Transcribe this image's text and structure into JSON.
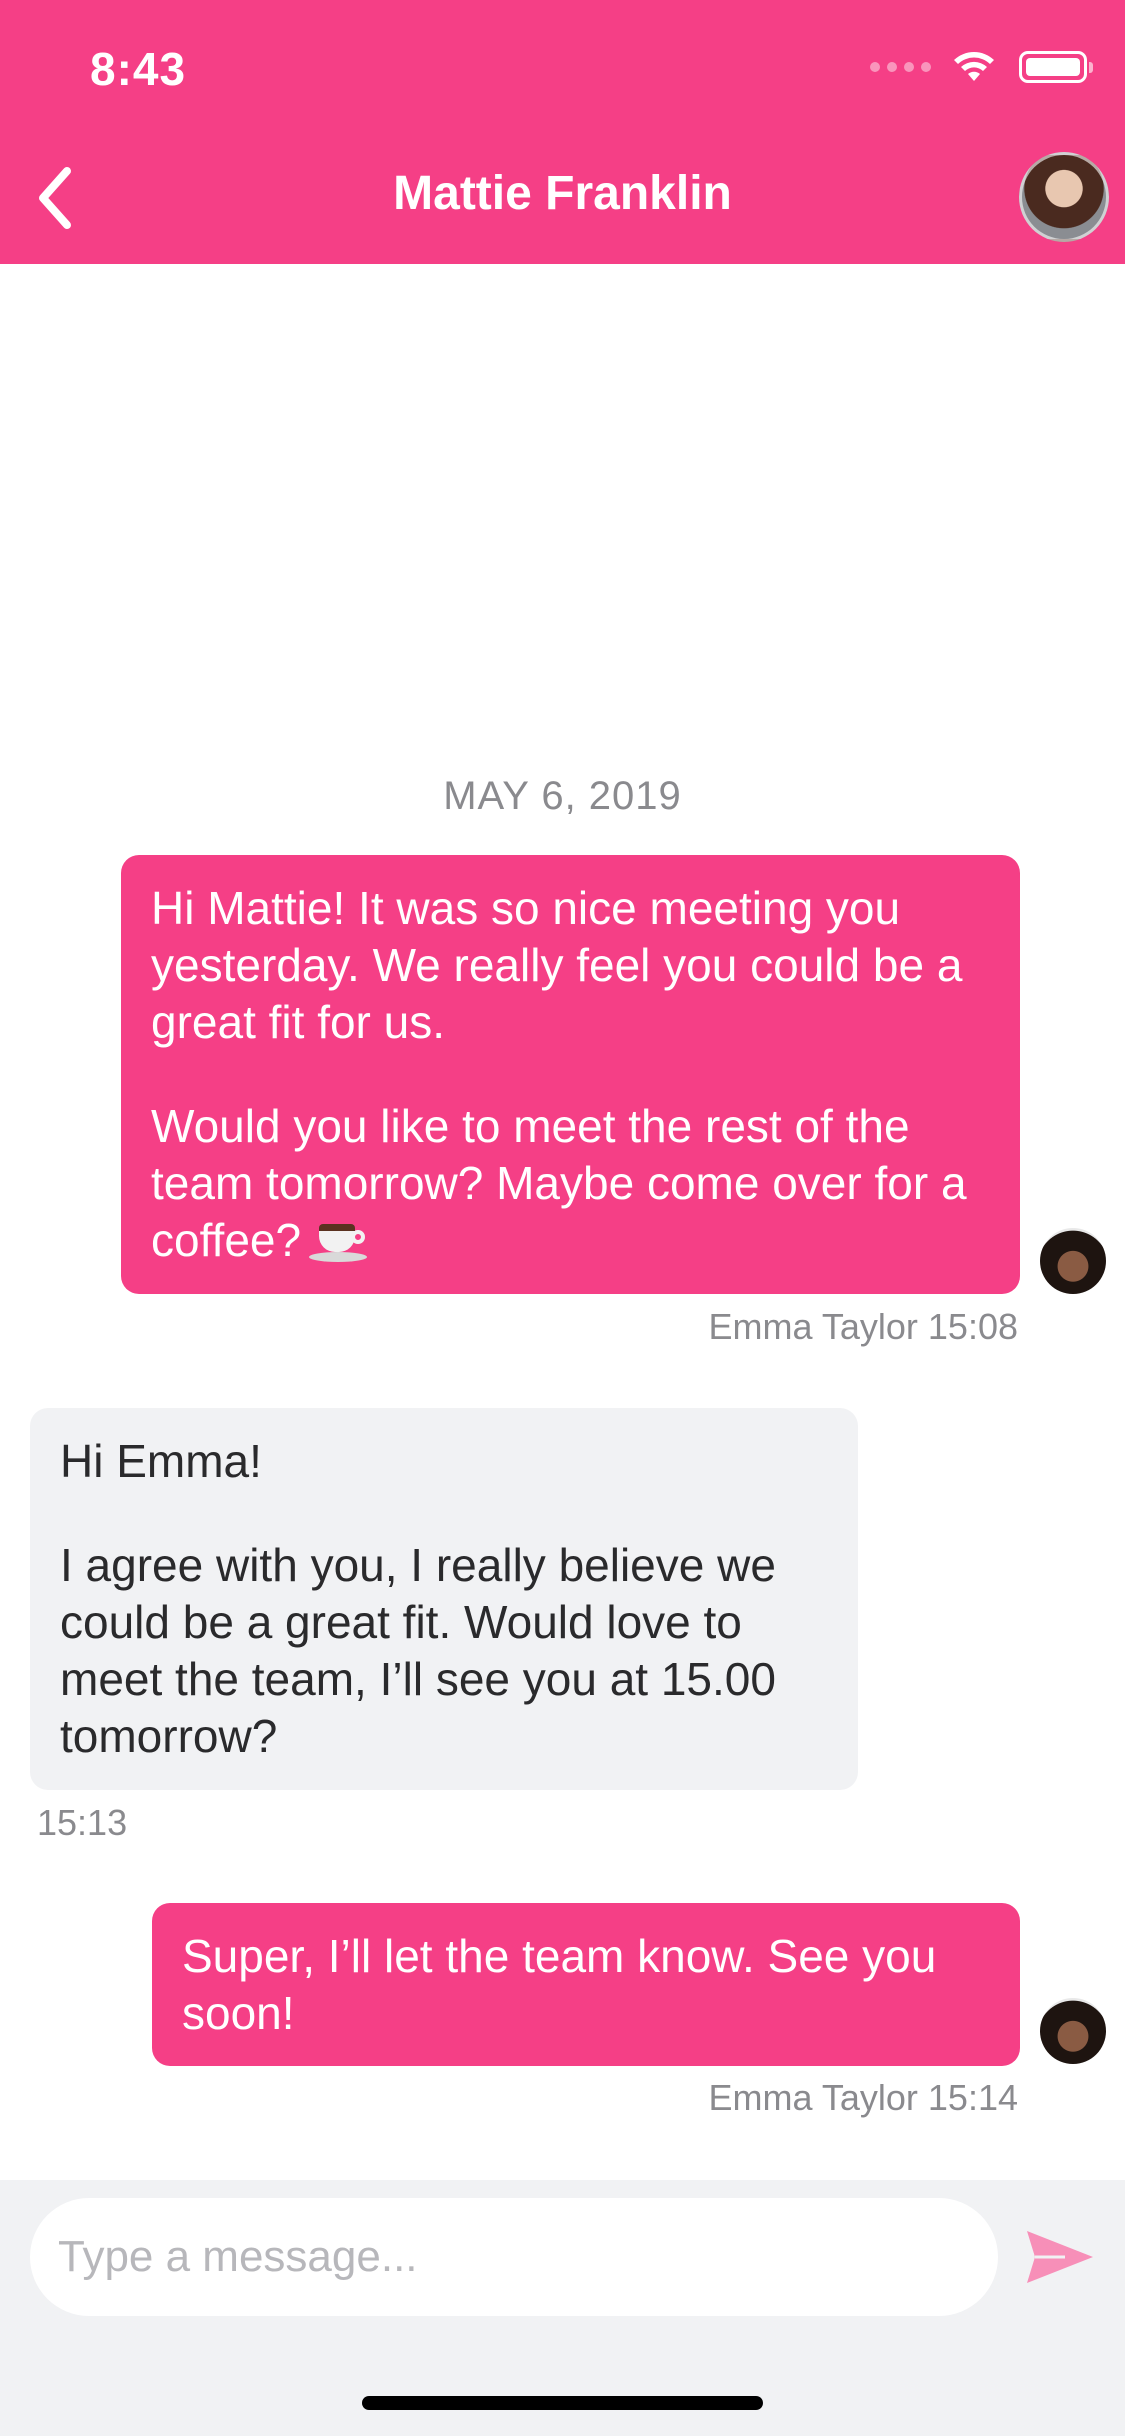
{
  "status_bar": {
    "time": "8:43",
    "icons": [
      "cellular-signal-icon",
      "wifi-icon",
      "battery-icon"
    ]
  },
  "header": {
    "title": "Mattie Franklin",
    "back_icon": "chevron-left-icon",
    "avatar": "contact-avatar"
  },
  "chat": {
    "date_separator": "MAY 6, 2019",
    "messages": [
      {
        "direction": "outgoing",
        "paragraphs": [
          "Hi Mattie! It was so nice meeting you yesterday. We really feel you could be a great fit for us.",
          "Would you like to meet the rest of the team tomorrow? Maybe come over for a coffee?"
        ],
        "emoji": "coffee-cup-icon",
        "meta": "Emma Taylor 15:08"
      },
      {
        "direction": "incoming",
        "paragraphs": [
          "Hi Emma!",
          "I agree with you, I really believe we could be a great fit. Would love to meet the team, I’ll see you at 15.00 tomorrow?"
        ],
        "meta": "15:13"
      },
      {
        "direction": "outgoing",
        "paragraphs": [
          "Super, I’ll let the team know. See you soon!"
        ],
        "meta": "Emma Taylor 15:14"
      }
    ]
  },
  "composer": {
    "placeholder": "Type a message...",
    "value": "",
    "send_icon": "send-icon"
  },
  "colors": {
    "accent": "#f53f86",
    "incoming_bubble": "#f1f2f4",
    "meta_text": "#8a8a8e"
  }
}
